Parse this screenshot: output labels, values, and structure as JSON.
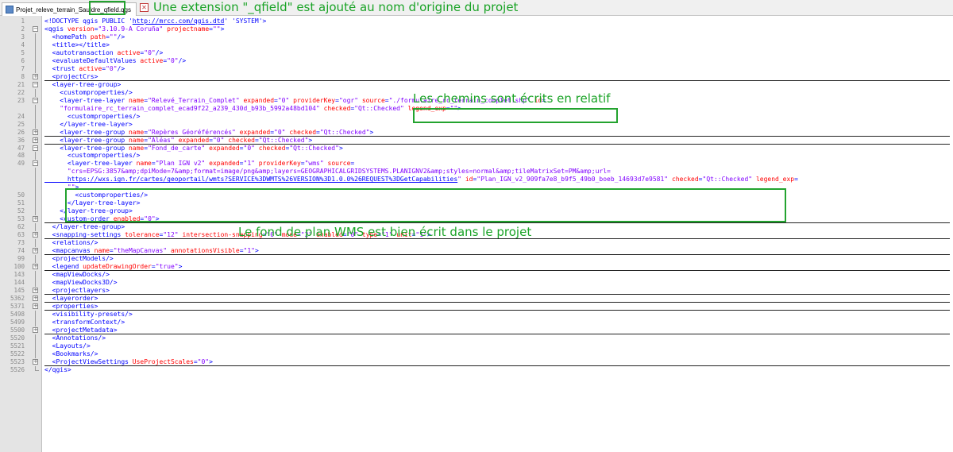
{
  "tab": {
    "filename": "Projet_releve_terrain_Sauldre_qfield.qgs"
  },
  "annotations": {
    "extension": "Une extension \"_qfield\" est ajouté au nom d'origine du projet",
    "relative_paths": "Les chemins sont écrits en relatif",
    "wms": "Le fond de plan WMS est bien écrit dans le projet"
  },
  "colors": {
    "annotation": "#23a32f",
    "tag": "#0000ff",
    "attr": "#ff0000",
    "value": "#8000ff"
  },
  "lines": [
    {
      "num": "1",
      "fold": "",
      "segs": [
        [
          "t",
          "<!DOCTYPE qgis PUBLIC '"
        ],
        [
          "u",
          "http://mrcc.com/qgis.dtd"
        ],
        [
          "t",
          "' 'SYSTEM'>"
        ]
      ]
    },
    {
      "num": "2",
      "fold": "-",
      "segs": [
        [
          "t",
          "<qgis "
        ],
        [
          "a",
          "version"
        ],
        [
          "t",
          "="
        ],
        [
          "v",
          "\"3.10.9-A Coruña\""
        ],
        [
          "t",
          " "
        ],
        [
          "a",
          "projectname"
        ],
        [
          "t",
          "="
        ],
        [
          "v",
          "\"\""
        ],
        [
          "t",
          ">"
        ]
      ]
    },
    {
      "num": "3",
      "fold": "|",
      "segs": [
        [
          "t",
          "  <homePath "
        ],
        [
          "a",
          "path"
        ],
        [
          "t",
          "="
        ],
        [
          "v",
          "\"\""
        ],
        [
          "t",
          "/>"
        ]
      ]
    },
    {
      "num": "4",
      "fold": "|",
      "segs": [
        [
          "t",
          "  <title></title>"
        ]
      ]
    },
    {
      "num": "5",
      "fold": "|",
      "segs": [
        [
          "t",
          "  <autotransaction "
        ],
        [
          "a",
          "active"
        ],
        [
          "t",
          "="
        ],
        [
          "v",
          "\"0\""
        ],
        [
          "t",
          "/>"
        ]
      ]
    },
    {
      "num": "6",
      "fold": "|",
      "segs": [
        [
          "t",
          "  <evaluateDefaultValues "
        ],
        [
          "a",
          "active"
        ],
        [
          "t",
          "="
        ],
        [
          "v",
          "\"0\""
        ],
        [
          "t",
          "/>"
        ]
      ]
    },
    {
      "num": "7",
      "fold": "|",
      "segs": [
        [
          "t",
          "  <trust "
        ],
        [
          "a",
          "active"
        ],
        [
          "t",
          "="
        ],
        [
          "v",
          "\"0\""
        ],
        [
          "t",
          "/>"
        ]
      ]
    },
    {
      "num": "8",
      "fold": "+",
      "sep": true,
      "segs": [
        [
          "t",
          "  <projectCrs>"
        ]
      ]
    },
    {
      "num": "21",
      "fold": "-",
      "segs": [
        [
          "t",
          "  <layer-tree-group>"
        ]
      ]
    },
    {
      "num": "22",
      "fold": "|",
      "segs": [
        [
          "t",
          "    <customproperties/>"
        ]
      ]
    },
    {
      "num": "23",
      "fold": "-",
      "segs": [
        [
          "t",
          "    <layer-tree-layer "
        ],
        [
          "a",
          "name"
        ],
        [
          "t",
          "="
        ],
        [
          "v",
          "\"Relevé_Terrain_Complet\""
        ],
        [
          "t",
          " "
        ],
        [
          "a",
          "expanded"
        ],
        [
          "t",
          "="
        ],
        [
          "v",
          "\"0\""
        ],
        [
          "t",
          " "
        ],
        [
          "a",
          "providerKey"
        ],
        [
          "t",
          "="
        ],
        [
          "v",
          "\"ogr\""
        ],
        [
          "t",
          " "
        ],
        [
          "a",
          "source"
        ],
        [
          "t",
          "="
        ],
        [
          "v",
          "\"./formulaire_rc_terrain_complet.shp\""
        ],
        [
          "t",
          " "
        ],
        [
          "a",
          "id"
        ],
        [
          "t",
          "="
        ]
      ]
    },
    {
      "num": "",
      "fold": "|",
      "segs": [
        [
          "v",
          "    \"formulaire_rc_terrain_complet_ecad9f22_a239_430d_b93b_5992a48bd104\""
        ],
        [
          "t",
          " "
        ],
        [
          "a",
          "checked"
        ],
        [
          "t",
          "="
        ],
        [
          "v",
          "\"Qt::Checked\""
        ],
        [
          "t",
          " "
        ],
        [
          "a",
          "legend_exp"
        ],
        [
          "t",
          "="
        ],
        [
          "v",
          "\"\""
        ],
        [
          "t",
          ">"
        ]
      ]
    },
    {
      "num": "24",
      "fold": "|",
      "segs": [
        [
          "t",
          "      <customproperties/>"
        ]
      ]
    },
    {
      "num": "25",
      "fold": "|",
      "segs": [
        [
          "t",
          "    </layer-tree-layer>"
        ]
      ]
    },
    {
      "num": "26",
      "fold": "+",
      "sep": true,
      "segs": [
        [
          "t",
          "    <layer-tree-group "
        ],
        [
          "a",
          "name"
        ],
        [
          "t",
          "="
        ],
        [
          "v",
          "\"Repères Géoréférencés\""
        ],
        [
          "t",
          " "
        ],
        [
          "a",
          "expanded"
        ],
        [
          "t",
          "="
        ],
        [
          "v",
          "\"0\""
        ],
        [
          "t",
          " "
        ],
        [
          "a",
          "checked"
        ],
        [
          "t",
          "="
        ],
        [
          "v",
          "\"Qt::Checked\""
        ],
        [
          "t",
          ">"
        ]
      ]
    },
    {
      "num": "36",
      "fold": "+",
      "sep": true,
      "segs": [
        [
          "t",
          "    <layer-tree-group "
        ],
        [
          "a",
          "name"
        ],
        [
          "t",
          "="
        ],
        [
          "v",
          "\"Aléas\""
        ],
        [
          "t",
          " "
        ],
        [
          "a",
          "expanded"
        ],
        [
          "t",
          "="
        ],
        [
          "v",
          "\"0\""
        ],
        [
          "t",
          " "
        ],
        [
          "a",
          "checked"
        ],
        [
          "t",
          "="
        ],
        [
          "v",
          "\"Qt::Checked\""
        ],
        [
          "t",
          ">"
        ]
      ]
    },
    {
      "num": "47",
      "fold": "-",
      "segs": [
        [
          "t",
          "    <layer-tree-group "
        ],
        [
          "a",
          "name"
        ],
        [
          "t",
          "="
        ],
        [
          "v",
          "\"Fond_de_carte\""
        ],
        [
          "t",
          " "
        ],
        [
          "a",
          "expanded"
        ],
        [
          "t",
          "="
        ],
        [
          "v",
          "\"0\""
        ],
        [
          "t",
          " "
        ],
        [
          "a",
          "checked"
        ],
        [
          "t",
          "="
        ],
        [
          "v",
          "\"Qt::Checked\""
        ],
        [
          "t",
          ">"
        ]
      ]
    },
    {
      "num": "48",
      "fold": "|",
      "segs": [
        [
          "t",
          "      <customproperties/>"
        ]
      ]
    },
    {
      "num": "49",
      "fold": "-",
      "segs": [
        [
          "t",
          "      <layer-tree-layer "
        ],
        [
          "a",
          "name"
        ],
        [
          "t",
          "="
        ],
        [
          "v",
          "\"Plan IGN v2\""
        ],
        [
          "t",
          " "
        ],
        [
          "a",
          "expanded"
        ],
        [
          "t",
          "="
        ],
        [
          "v",
          "\"1\""
        ],
        [
          "t",
          " "
        ],
        [
          "a",
          "providerKey"
        ],
        [
          "t",
          "="
        ],
        [
          "v",
          "\"wms\""
        ],
        [
          "t",
          " "
        ],
        [
          "a",
          "source"
        ],
        [
          "t",
          "="
        ]
      ]
    },
    {
      "num": "",
      "fold": "|",
      "segs": [
        [
          "v",
          "      \"crs=EPSG:3857&amp;dpiMode=7&amp;format=image/png&amp;layers=GEOGRAPHICALGRIDSYSTEMS.PLANIGNV2&amp;styles=normal&amp;tileMatrixSet=PM&amp;url="
        ]
      ]
    },
    {
      "num": "",
      "fold": "|",
      "segs": [
        [
          "u",
          "      https://wxs.ign.fr/cartes/geoportail/wmts?SERVICE%3DWMTS%26VERSION%3D1.0.0%26REQUEST%3DGetCapabilities"
        ],
        [
          "v",
          "\""
        ],
        [
          "t",
          " "
        ],
        [
          "a",
          "id"
        ],
        [
          "t",
          "="
        ],
        [
          "v",
          "\"Plan_IGN_v2_909fa7e8_b9f5_49b0_boeb_14693d7e9581\""
        ],
        [
          "t",
          " "
        ],
        [
          "a",
          "checked"
        ],
        [
          "t",
          "="
        ],
        [
          "v",
          "\"Qt::Checked\""
        ],
        [
          "t",
          " "
        ],
        [
          "a",
          "legend_exp"
        ],
        [
          "t",
          "="
        ]
      ]
    },
    {
      "num": "",
      "fold": "|",
      "segs": [
        [
          "v",
          "      \"\""
        ],
        [
          "t",
          ">"
        ]
      ]
    },
    {
      "num": "50",
      "fold": "|",
      "segs": [
        [
          "t",
          "        <customproperties/>"
        ]
      ]
    },
    {
      "num": "51",
      "fold": "|",
      "segs": [
        [
          "t",
          "      </layer-tree-layer>"
        ]
      ]
    },
    {
      "num": "52",
      "fold": "|",
      "segs": [
        [
          "t",
          "    </layer-tree-group>"
        ]
      ]
    },
    {
      "num": "53",
      "fold": "+",
      "sep": true,
      "segs": [
        [
          "t",
          "    <custom-order "
        ],
        [
          "a",
          "enabled"
        ],
        [
          "t",
          "="
        ],
        [
          "v",
          "\"0\""
        ],
        [
          "t",
          ">"
        ]
      ]
    },
    {
      "num": "62",
      "fold": "|",
      "segs": [
        [
          "t",
          "  </layer-tree-group>"
        ]
      ]
    },
    {
      "num": "63",
      "fold": "+",
      "sep": true,
      "segs": [
        [
          "t",
          "  <snapping-settings "
        ],
        [
          "a",
          "tolerance"
        ],
        [
          "t",
          "="
        ],
        [
          "v",
          "\"12\""
        ],
        [
          "t",
          " "
        ],
        [
          "a",
          "intersection-snapping"
        ],
        [
          "t",
          "="
        ],
        [
          "v",
          "\"0\""
        ],
        [
          "t",
          " "
        ],
        [
          "a",
          "mode"
        ],
        [
          "t",
          "="
        ],
        [
          "v",
          "\"2\""
        ],
        [
          "t",
          " "
        ],
        [
          "a",
          "enabled"
        ],
        [
          "t",
          "="
        ],
        [
          "v",
          "\"0\""
        ],
        [
          "t",
          " "
        ],
        [
          "a",
          "type"
        ],
        [
          "t",
          "="
        ],
        [
          "v",
          "\"1\""
        ],
        [
          "t",
          " "
        ],
        [
          "a",
          "unit"
        ],
        [
          "t",
          "="
        ],
        [
          "v",
          "\"1\""
        ],
        [
          "t",
          ">"
        ]
      ]
    },
    {
      "num": "73",
      "fold": "|",
      "segs": [
        [
          "t",
          "  <relations/>"
        ]
      ]
    },
    {
      "num": "74",
      "fold": "+",
      "sep": true,
      "segs": [
        [
          "t",
          "  <mapcanvas "
        ],
        [
          "a",
          "name"
        ],
        [
          "t",
          "="
        ],
        [
          "v",
          "\"theMapCanvas\""
        ],
        [
          "t",
          " "
        ],
        [
          "a",
          "annotationsVisible"
        ],
        [
          "t",
          "="
        ],
        [
          "v",
          "\"1\""
        ],
        [
          "t",
          ">"
        ]
      ]
    },
    {
      "num": "99",
      "fold": "|",
      "segs": [
        [
          "t",
          "  <projectModels/>"
        ]
      ]
    },
    {
      "num": "100",
      "fold": "+",
      "sep": true,
      "segs": [
        [
          "t",
          "  <legend "
        ],
        [
          "a",
          "updateDrawingOrder"
        ],
        [
          "t",
          "="
        ],
        [
          "v",
          "\"true\""
        ],
        [
          "t",
          ">"
        ]
      ]
    },
    {
      "num": "143",
      "fold": "|",
      "segs": [
        [
          "t",
          "  <mapViewDocks/>"
        ]
      ]
    },
    {
      "num": "144",
      "fold": "|",
      "segs": [
        [
          "t",
          "  <mapViewDocks3D/>"
        ]
      ]
    },
    {
      "num": "145",
      "fold": "+",
      "sep": true,
      "segs": [
        [
          "t",
          "  <projectlayers>"
        ]
      ]
    },
    {
      "num": "5362",
      "fold": "+",
      "sep": true,
      "segs": [
        [
          "t",
          "  <layerorder>"
        ]
      ]
    },
    {
      "num": "5371",
      "fold": "+",
      "sep": true,
      "segs": [
        [
          "t",
          "  <properties>"
        ]
      ]
    },
    {
      "num": "5498",
      "fold": "|",
      "segs": [
        [
          "t",
          "  <visibility-presets/>"
        ]
      ]
    },
    {
      "num": "5499",
      "fold": "|",
      "segs": [
        [
          "t",
          "  <transformContext/>"
        ]
      ]
    },
    {
      "num": "5500",
      "fold": "+",
      "sep": true,
      "segs": [
        [
          "t",
          "  <projectMetadata>"
        ]
      ]
    },
    {
      "num": "5520",
      "fold": "|",
      "segs": [
        [
          "t",
          "  <Annotations/>"
        ]
      ]
    },
    {
      "num": "5521",
      "fold": "|",
      "segs": [
        [
          "t",
          "  <Layouts/>"
        ]
      ]
    },
    {
      "num": "5522",
      "fold": "|",
      "segs": [
        [
          "t",
          "  <Bookmarks/>"
        ]
      ]
    },
    {
      "num": "5523",
      "fold": "+",
      "sep": true,
      "segs": [
        [
          "t",
          "  <ProjectViewSettings "
        ],
        [
          "a",
          "UseProjectScales"
        ],
        [
          "t",
          "="
        ],
        [
          "v",
          "\"0\""
        ],
        [
          "t",
          ">"
        ]
      ]
    },
    {
      "num": "5526",
      "fold": "end",
      "segs": [
        [
          "t",
          "</qgis>"
        ]
      ]
    }
  ]
}
